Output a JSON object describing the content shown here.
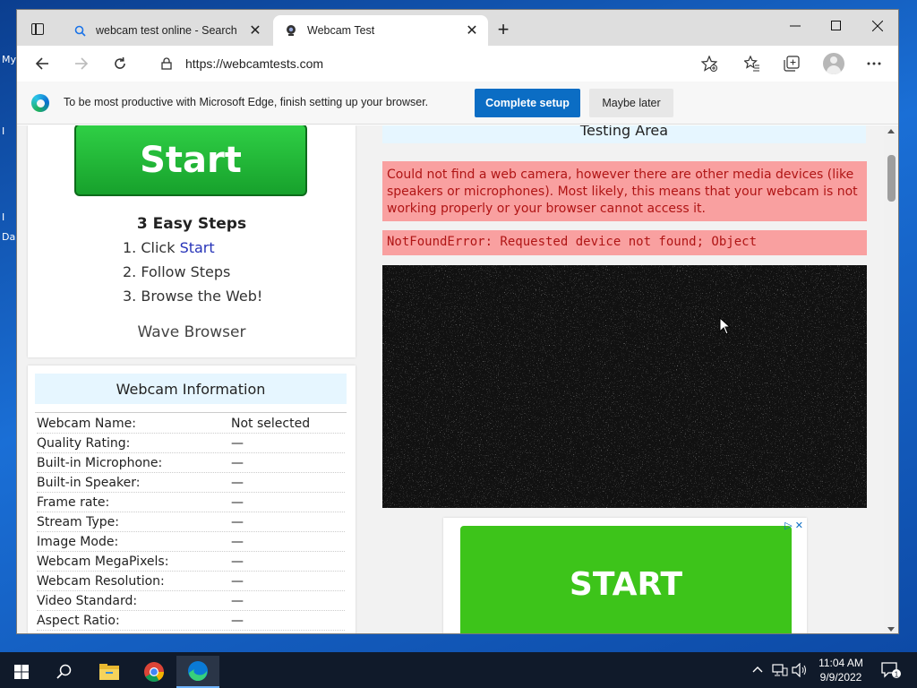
{
  "desktop": {
    "labels": [
      "My",
      "I",
      "I",
      "Da"
    ]
  },
  "browser": {
    "tabs": [
      {
        "title": "webcam test online - Search",
        "icon": "search-icon"
      },
      {
        "title": "Webcam Test",
        "icon": "webcam-icon"
      }
    ],
    "url": "https://webcamtests.com"
  },
  "infobar": {
    "message": "To be most productive with Microsoft Edge, finish setting up your browser.",
    "primary": "Complete setup",
    "secondary": "Maybe later"
  },
  "promo": {
    "start_label": "Start",
    "steps_title": "3 Easy Steps",
    "steps": [
      {
        "prefix": "1. Click ",
        "link": "Start"
      },
      {
        "prefix": "2. Follow Steps",
        "link": ""
      },
      {
        "prefix": "3. Browse the Web!",
        "link": ""
      }
    ],
    "brand": "Wave Browser"
  },
  "webcam_info": {
    "title": "Webcam Information",
    "rows": [
      {
        "key": "Webcam Name:",
        "value": "Not selected"
      },
      {
        "key": "Quality Rating:",
        "value": "—"
      },
      {
        "key": "Built-in Microphone:",
        "value": "—"
      },
      {
        "key": "Built-in Speaker:",
        "value": "—"
      },
      {
        "key": "Frame rate:",
        "value": "—"
      },
      {
        "key": "Stream Type:",
        "value": "—"
      },
      {
        "key": "Image Mode:",
        "value": "—"
      },
      {
        "key": "Webcam MegaPixels:",
        "value": "—"
      },
      {
        "key": "Webcam Resolution:",
        "value": "—"
      },
      {
        "key": "Video Standard:",
        "value": "—"
      },
      {
        "key": "Aspect Ratio:",
        "value": "—"
      }
    ]
  },
  "testing": {
    "title": "Testing Area",
    "error_message": "Could not find a web camera, however there are other media devices (like speakers or microphones). Most likely, this means that your webcam is not working properly or your browser cannot access it.",
    "error_detail": "NotFoundError: Requested device not found; Object"
  },
  "ad": {
    "label": "START"
  },
  "taskbar": {
    "time": "11:04 AM",
    "date": "9/9/2022",
    "notifications": "1"
  },
  "colors": {
    "accent": "#0b6dc4",
    "error_bg": "#f9a0a0",
    "error_text": "#b01515",
    "start_green": "#3dc41a"
  }
}
